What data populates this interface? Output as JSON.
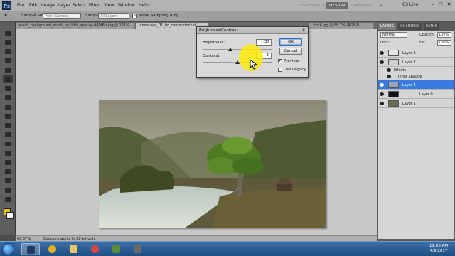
{
  "menubar": {
    "app_icon": "Ps",
    "items": [
      "File",
      "Edit",
      "Image",
      "Layer",
      "Select",
      "Filter",
      "View",
      "Window",
      "Help"
    ],
    "workspaces": [
      "ESSENTIALS",
      "DESIGN",
      "PAINTING"
    ],
    "overflow": "»",
    "cs_live": "CS Live",
    "window_controls": [
      "–",
      "□",
      "✕"
    ]
  },
  "options": {
    "sample_size_label": "Sample Size:",
    "sample_size_value": "Point Sample",
    "sample_label": "Sample:",
    "sample_value": "All Layers",
    "show_ring_label": "Show Sampling Ring",
    "show_ring_checked": true
  },
  "document_tabs": [
    {
      "label": "beach_background_stock_by_little_spacey-d49t6b.jpg @ 121% ...",
      "active": false
    },
    {
      "label": "landscape_01_by_cemacstock-d...",
      "active": true
    },
    {
      "label": "...tock.jpg @ 88.7% (RGB/8...",
      "active": false
    }
  ],
  "status": {
    "zoom": "66.67%",
    "message": "Exposure works in 32-bit only"
  },
  "dialog": {
    "title": "Brightness/Contrast",
    "brightness_label": "Brightness:",
    "brightness_value": "-37",
    "contrast_label": "Contrast:",
    "contrast_value": "0",
    "ok_label": "OK",
    "cancel_label": "Cancel",
    "preview_label": "Preview",
    "preview_checked": true,
    "legacy_label": "Use Legacy",
    "legacy_checked": false
  },
  "panels": {
    "tabs": [
      "LAYERS",
      "CHANNELS",
      "PATHS"
    ],
    "blend_mode": "Normal",
    "opacity_label": "Opacity:",
    "opacity_value": "100%",
    "lock_label": "Lock:",
    "fill_label": "Fill:",
    "fill_value": "100%",
    "layers": [
      {
        "name": "Layer 3",
        "selected": false
      },
      {
        "name": "Layer 2",
        "selected": false
      },
      {
        "name": "Effects",
        "kind": "fx"
      },
      {
        "name": "Inner Shadow",
        "kind": "fx"
      },
      {
        "name": "Layer 4",
        "selected": true
      },
      {
        "name": "Layer 0",
        "selected": false
      },
      {
        "name": "Layer 1",
        "selected": false
      }
    ]
  },
  "taskbar": {
    "time": "11:00 AM",
    "date": "4/9/2017"
  },
  "colors": {
    "selection": "#3a7ae0",
    "highlight": "#ffeb00",
    "workspace_bg": "#c8c8c8"
  },
  "icons": [
    "ps-logo",
    "eye-icon",
    "start-orb",
    "chrome-icon",
    "folder-icon",
    "mouse-cursor-icon"
  ]
}
